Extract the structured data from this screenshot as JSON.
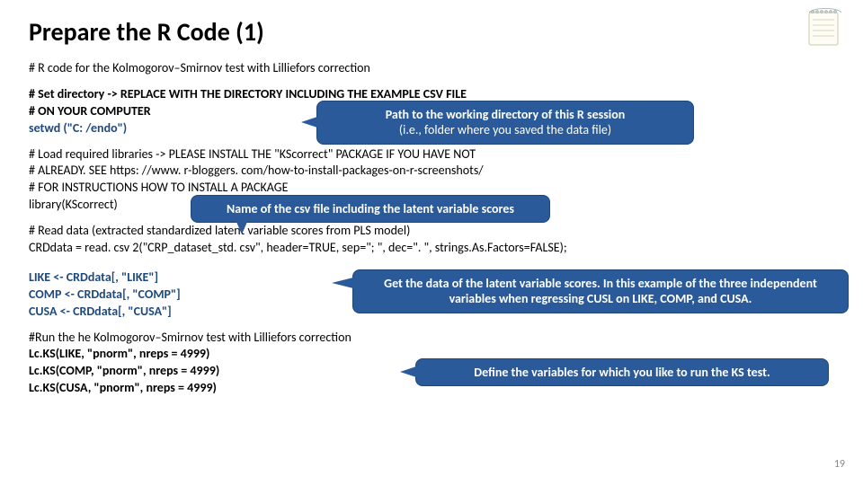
{
  "title": "Prepare the R Code (1)",
  "intro": "# R code for the Kolmogorov–Smirnov test with Lilliefors correction",
  "setdir": {
    "l1": "# Set directory -> REPLACE WITH THE DIRECTORY INCLUDING THE EXAMPLE CSV FILE",
    "l2": "# ON YOUR COMPUTER",
    "l3": "setwd (\"C: /endo\")"
  },
  "callout_path": {
    "line1": "Path to the working directory of this R session",
    "line2": "(i.e., folder where you saved the data file)"
  },
  "load": {
    "l1": "# Load required libraries -> PLEASE INSTALL THE \"KScorrect\" PACKAGE IF YOU HAVE NOT",
    "l2": "# ALREADY. SEE https: //www. r-bloggers. com/how-to-install-packages-on-r-screenshots/",
    "l3": "# FOR INSTRUCTIONS HOW TO INSTALL A PACKAGE",
    "l4": "library(KScorrect)"
  },
  "callout_csv": "Name of the csv file including the latent variable scores",
  "read": {
    "l1": "# Read data (extracted standardized latent variable scores from PLS model)",
    "l2": "CRDdata = read. csv 2(\"CRP_dataset_std. csv\", header=TRUE, sep=\"; \", dec=\". \", strings.As.Factors=FALSE);"
  },
  "vars": {
    "l1": "LIKE <- CRDdata[, \"LIKE\"]",
    "l2": "COMP <- CRDdata[, \"COMP\"]",
    "l3": "CUSA <- CRDdata[, \"CUSA\"]"
  },
  "callout_getdata": "Get the data of the latent variable scores. In this example of the three independent variables when regressing CUSL on LIKE, COMP, and CUSA.",
  "run": {
    "l1": "#Run the he Kolmogorov–Smirnov test with Lilliefors correction",
    "l2": "Lc.KS(LIKE, \"pnorm\", nreps = 4999)",
    "l3": "Lc.KS(COMP, \"pnorm\", nreps = 4999)",
    "l4": "Lc.KS(CUSA, \"pnorm\", nreps = 4999)"
  },
  "callout_define": "Define the variables for which you like to run the KS test.",
  "pagenum": "19"
}
